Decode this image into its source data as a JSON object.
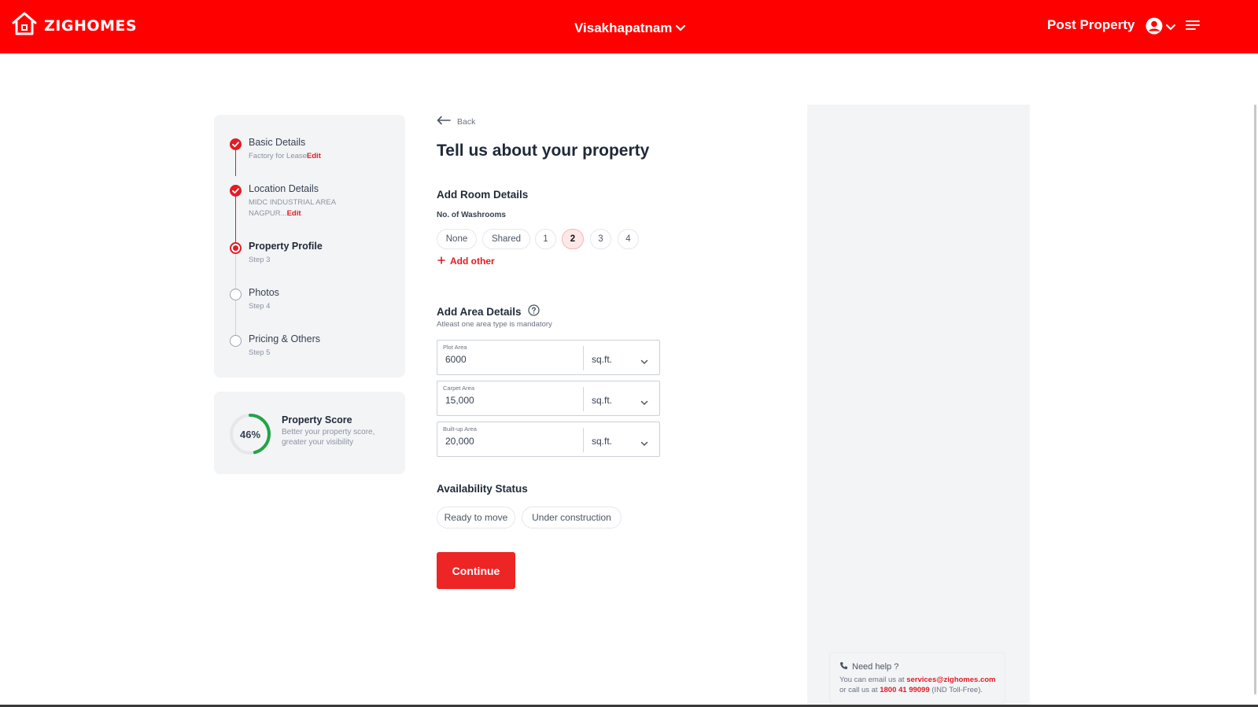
{
  "header": {
    "logo_text": "ZIGHOMES",
    "city": "Visakhapatnam",
    "post_property": "Post Property",
    "brand_color": "#ff0000"
  },
  "stepper": {
    "steps": [
      {
        "title": "Basic Details",
        "sub": "Factory for Lease",
        "edit": "Edit",
        "status": "done"
      },
      {
        "title": "Location Details",
        "sub1": "MIDC INDUSTRIAL AREA",
        "sub2": "NAGPUR...",
        "edit": "Edit",
        "status": "done"
      },
      {
        "title": "Property Profile",
        "sub": "Step 3",
        "status": "current"
      },
      {
        "title": "Photos",
        "sub": "Step 4",
        "status": "todo"
      },
      {
        "title": "Pricing & Others",
        "sub": "Step 5",
        "status": "todo"
      }
    ]
  },
  "score": {
    "value_text": "46%",
    "progress": 0.46,
    "title": "Property Score",
    "subtitle": "Better your property score, greater your visibility"
  },
  "form": {
    "back": "Back",
    "heading": "Tell us about your property",
    "room_section": "Add Room Details",
    "washrooms_label": "No. of Washrooms",
    "washroom_options": [
      "None",
      "Shared",
      "1",
      "2",
      "3",
      "4"
    ],
    "washroom_selected": "2",
    "add_other": "Add other",
    "area_section": "Add Area Details",
    "area_hint": "Atleast one area type is mandatory",
    "areas": [
      {
        "label": "Plot Area",
        "value": "6000",
        "unit": "sq.ft."
      },
      {
        "label": "Carpet Area",
        "value": "15,000",
        "unit": "sq.ft."
      },
      {
        "label": "Built-up Area",
        "value": "20,000",
        "unit": "sq.ft."
      }
    ],
    "availability_section": "Availability Status",
    "availability_options": [
      "Ready to move",
      "Under construction"
    ],
    "continue": "Continue"
  },
  "help": {
    "title": "Need help ?",
    "email_prefix": "You can email us at ",
    "email": "services@zighomes.com",
    "call_prefix": "or call us at ",
    "phone": "1800 41 99099",
    "phone_suffix": " (IND Toll-Free)."
  }
}
